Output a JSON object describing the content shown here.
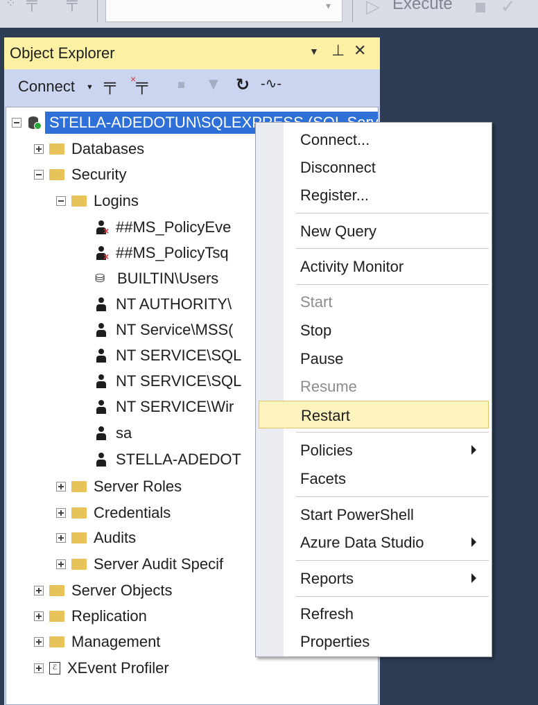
{
  "toolbar": {
    "execute_label": "Execute"
  },
  "object_explorer": {
    "title": "Object Explorer",
    "connect_label": "Connect",
    "tree": {
      "server": "STELLA-ADEDOTUN\\SQLEXPRESS (SQL Server",
      "databases": "Databases",
      "security": "Security",
      "logins": "Logins",
      "login_items": [
        "##MS_PolicyEve",
        "##MS_PolicyTsq",
        "BUILTIN\\Users",
        "NT AUTHORITY\\",
        "NT Service\\MSS(",
        "NT SERVICE\\SQL",
        "NT SERVICE\\SQL",
        "NT SERVICE\\Wir",
        "sa",
        "STELLA-ADEDOT"
      ],
      "server_roles": "Server Roles",
      "credentials": "Credentials",
      "audits": "Audits",
      "server_audit_specs": "Server Audit Specif",
      "server_objects": "Server Objects",
      "replication": "Replication",
      "management": "Management",
      "xevent_profiler": "XEvent Profiler"
    }
  },
  "context_menu": {
    "items": [
      "Connect...",
      "Disconnect",
      "Register...",
      "New Query",
      "Activity Monitor",
      "Start",
      "Stop",
      "Pause",
      "Resume",
      "Restart",
      "Policies",
      "Facets",
      "Start PowerShell",
      "Azure Data Studio",
      "Reports",
      "Refresh",
      "Properties"
    ],
    "highlighted": "Restart",
    "disabled": [
      "Start",
      "Resume"
    ],
    "highlight_color": "#fdf4bd"
  },
  "colors": {
    "background": "#2d3c54",
    "title_bar": "#fcf0a5",
    "selection": "#2e6fd8"
  }
}
